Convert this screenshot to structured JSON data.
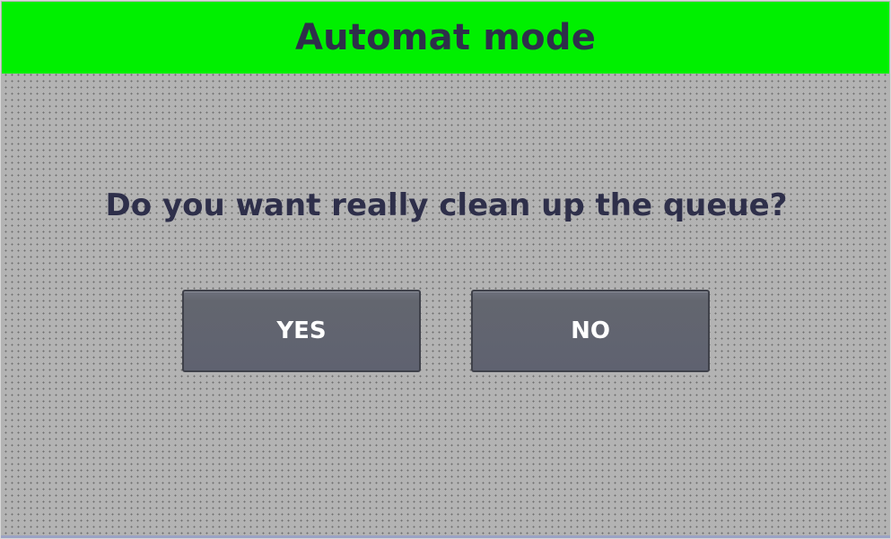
{
  "header": {
    "title": "Automat mode",
    "background_color": "#00f000",
    "text_color": "#2e2f4a"
  },
  "dialog": {
    "question": "Do you want really clean up the queue?"
  },
  "buttons": {
    "yes_label": "YES",
    "no_label": "NO",
    "button_color": "#63666f",
    "label_color": "#ffffff"
  },
  "background": {
    "color": "#b3b3b3",
    "pattern": "dotted-grid"
  }
}
